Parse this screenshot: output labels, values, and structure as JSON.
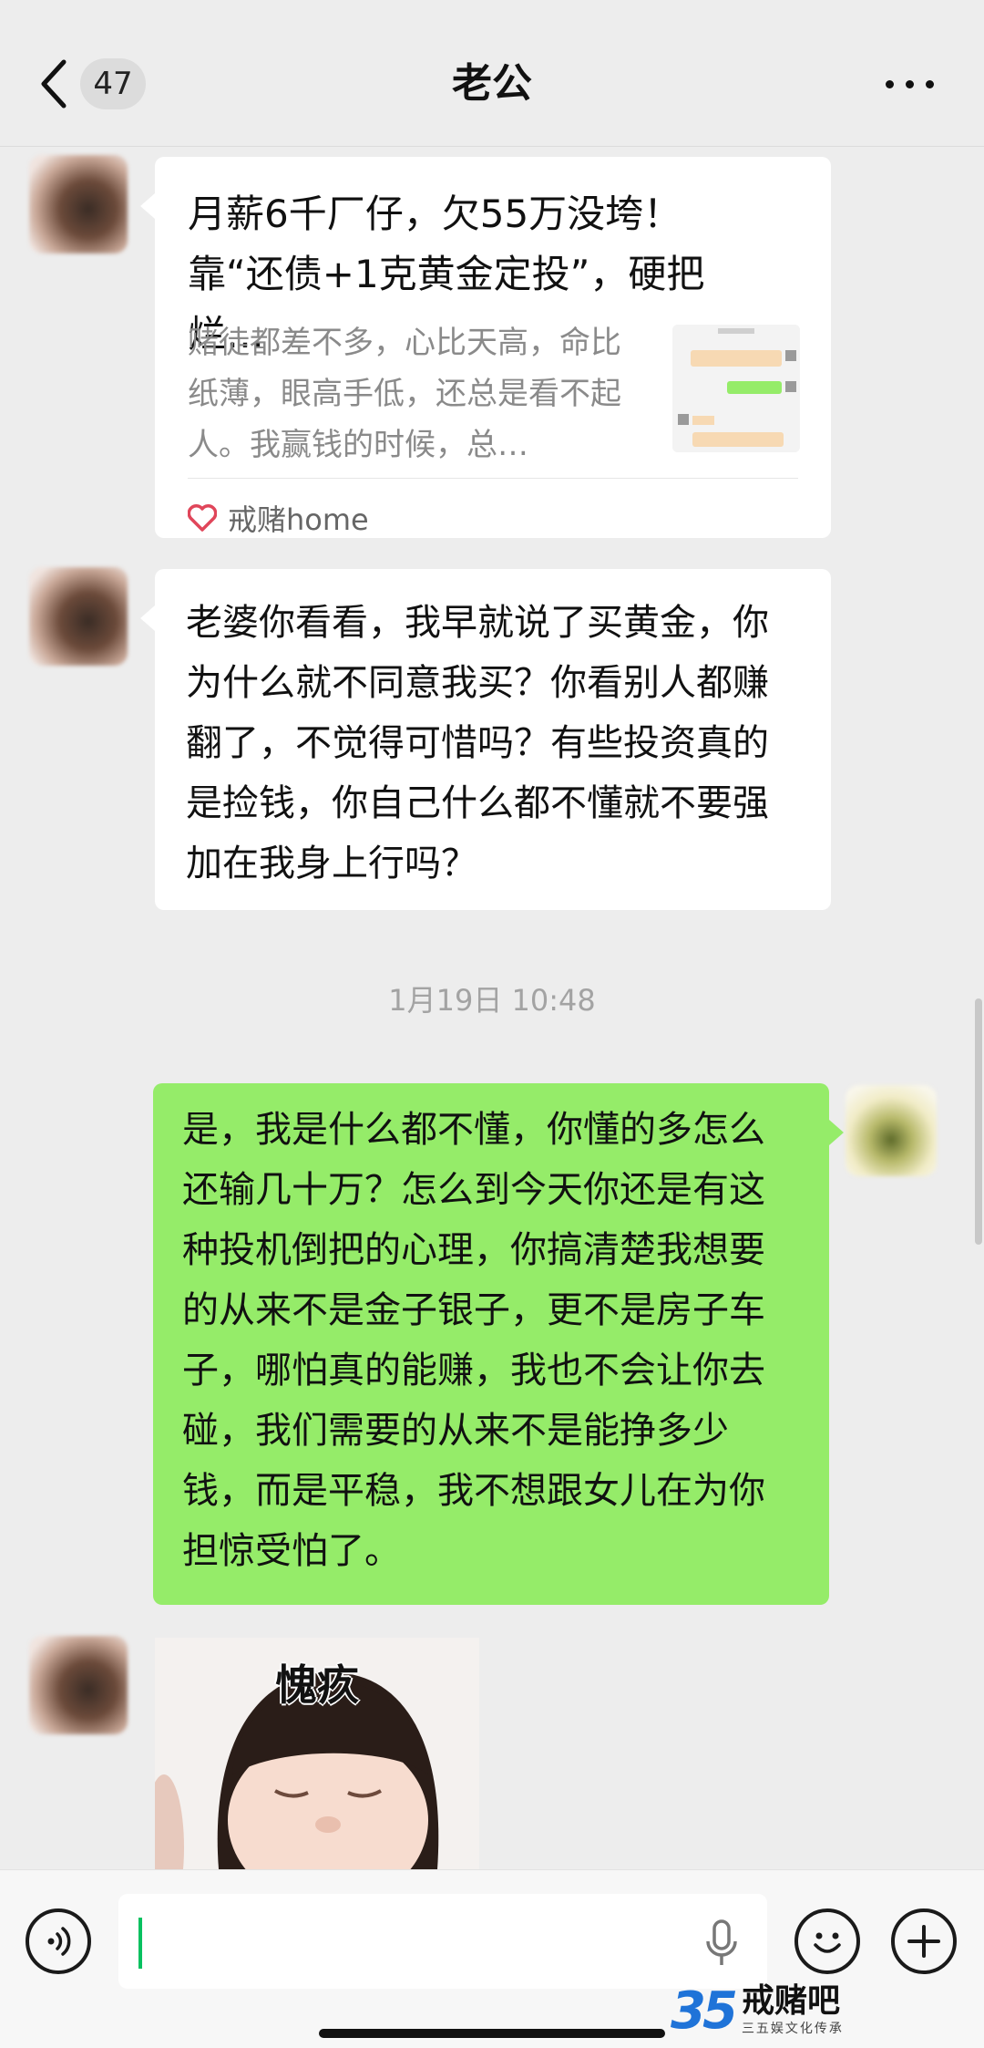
{
  "header": {
    "unread_count": "47",
    "title": "老公"
  },
  "messages": {
    "link_card": {
      "title": "月薪6千厂仔，欠55万没垮！靠“还债+1克黄金定投”，硬把烂…",
      "description": "赌徒都差不多，心比天高，命比纸薄，眼高手低，还总是看不起人。我赢钱的时候，总…",
      "source": "戒赌home",
      "source_icon": "heart-icon"
    },
    "husband_text": "老婆你看看，我早就说了买黄金，你为什么就不同意我买？你看别人都赚翻了，不觉得可惜吗？有些投资真的是捡钱，你自己什么都不懂就不要强加在我身上行吗？",
    "timestamp": "1月19日 10:48",
    "my_reply": "是，我是什么都不懂，你懂的多怎么还输几十万？怎么到今天你还是有这种投机倒把的心理，你搞清楚我想要的从来不是金子银子，更不是房子车子，哪怕真的能赚，我也不会让你去碰，我们需要的从来不是能挣多少钱，而是平稳，我不想跟女儿在为你担惊受怕了。",
    "sticker_caption": "愧疚"
  },
  "watermark": {
    "number": "35",
    "title": "戒赌吧",
    "subtitle": "三五娱文化传承"
  },
  "colors": {
    "background": "#ededed",
    "my_bubble": "#95ec69",
    "other_bubble": "#ffffff",
    "caret": "#07c160"
  }
}
